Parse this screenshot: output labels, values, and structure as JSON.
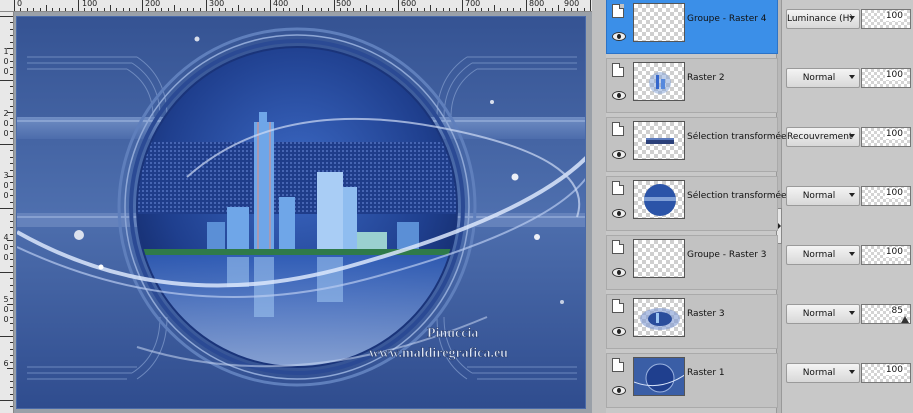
{
  "ruler": {
    "top_labels": [
      "0",
      "100",
      "200",
      "300",
      "400",
      "500",
      "600",
      "700",
      "800",
      "900"
    ],
    "left_labels": [
      "1",
      "0",
      "0",
      "2",
      "0",
      "0",
      "3",
      "0",
      "0",
      "4",
      "0",
      "0",
      "5",
      "0",
      "0",
      "6"
    ]
  },
  "canvas": {
    "watermark_name": "Pinuccia",
    "watermark_url": "www.maldiregrafica.eu"
  },
  "layers": [
    {
      "name": "Groupe - Raster 4",
      "blend": "Luminance (H)",
      "opacity": "100",
      "selected": true,
      "thumb": "empty"
    },
    {
      "name": "Raster 2",
      "blend": "Normal",
      "opacity": "100",
      "selected": false,
      "thumb": "small-city"
    },
    {
      "name": "Sélection transformée",
      "blend": "Recouvrement",
      "opacity": "100",
      "selected": false,
      "thumb": "bar"
    },
    {
      "name": "Sélection transformée",
      "blend": "Normal",
      "opacity": "100",
      "selected": false,
      "thumb": "circle"
    },
    {
      "name": "Groupe - Raster 3",
      "blend": "Normal",
      "opacity": "100",
      "selected": false,
      "thumb": "empty"
    },
    {
      "name": "Raster 3",
      "blend": "Normal",
      "opacity": "85",
      "selected": false,
      "thumb": "glow"
    },
    {
      "name": "Raster 1",
      "blend": "Normal",
      "opacity": "100",
      "selected": false,
      "thumb": "full"
    }
  ],
  "colors": {
    "selected_row": "#3b8fe8",
    "canvas_blue": "#3c5da0"
  }
}
